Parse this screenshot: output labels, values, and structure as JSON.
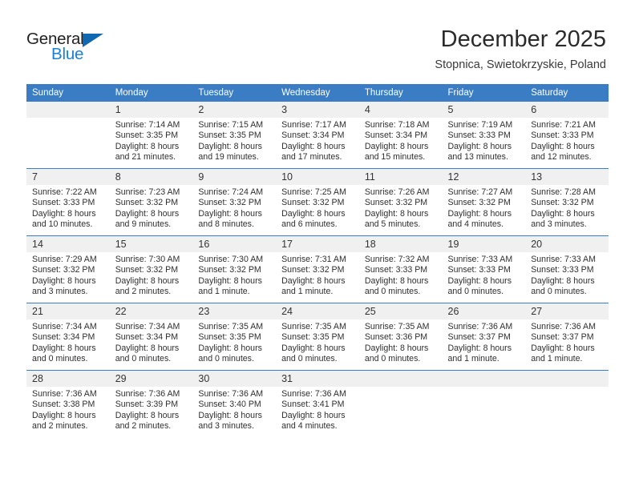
{
  "brand": {
    "name_top": "General",
    "name_bottom": "Blue",
    "color_dark": "#222222",
    "color_blue": "#1b7fd4",
    "triangle_color": "#1068b0"
  },
  "header": {
    "title": "December 2025",
    "subtitle": "Stopnica, Swietokrzyskie, Poland"
  },
  "theme": {
    "header_bg": "#3b7dc4",
    "header_text": "#ffffff",
    "daynum_bg": "#f0f0f0",
    "row_divider": "#3b7dc4"
  },
  "weekday_headers": [
    "Sunday",
    "Monday",
    "Tuesday",
    "Wednesday",
    "Thursday",
    "Friday",
    "Saturday"
  ],
  "weeks": [
    [
      {
        "day": "",
        "sunrise": "",
        "sunset": "",
        "daylight1": "",
        "daylight2": ""
      },
      {
        "day": "1",
        "sunrise": "Sunrise: 7:14 AM",
        "sunset": "Sunset: 3:35 PM",
        "daylight1": "Daylight: 8 hours",
        "daylight2": "and 21 minutes."
      },
      {
        "day": "2",
        "sunrise": "Sunrise: 7:15 AM",
        "sunset": "Sunset: 3:35 PM",
        "daylight1": "Daylight: 8 hours",
        "daylight2": "and 19 minutes."
      },
      {
        "day": "3",
        "sunrise": "Sunrise: 7:17 AM",
        "sunset": "Sunset: 3:34 PM",
        "daylight1": "Daylight: 8 hours",
        "daylight2": "and 17 minutes."
      },
      {
        "day": "4",
        "sunrise": "Sunrise: 7:18 AM",
        "sunset": "Sunset: 3:34 PM",
        "daylight1": "Daylight: 8 hours",
        "daylight2": "and 15 minutes."
      },
      {
        "day": "5",
        "sunrise": "Sunrise: 7:19 AM",
        "sunset": "Sunset: 3:33 PM",
        "daylight1": "Daylight: 8 hours",
        "daylight2": "and 13 minutes."
      },
      {
        "day": "6",
        "sunrise": "Sunrise: 7:21 AM",
        "sunset": "Sunset: 3:33 PM",
        "daylight1": "Daylight: 8 hours",
        "daylight2": "and 12 minutes."
      }
    ],
    [
      {
        "day": "7",
        "sunrise": "Sunrise: 7:22 AM",
        "sunset": "Sunset: 3:33 PM",
        "daylight1": "Daylight: 8 hours",
        "daylight2": "and 10 minutes."
      },
      {
        "day": "8",
        "sunrise": "Sunrise: 7:23 AM",
        "sunset": "Sunset: 3:32 PM",
        "daylight1": "Daylight: 8 hours",
        "daylight2": "and 9 minutes."
      },
      {
        "day": "9",
        "sunrise": "Sunrise: 7:24 AM",
        "sunset": "Sunset: 3:32 PM",
        "daylight1": "Daylight: 8 hours",
        "daylight2": "and 8 minutes."
      },
      {
        "day": "10",
        "sunrise": "Sunrise: 7:25 AM",
        "sunset": "Sunset: 3:32 PM",
        "daylight1": "Daylight: 8 hours",
        "daylight2": "and 6 minutes."
      },
      {
        "day": "11",
        "sunrise": "Sunrise: 7:26 AM",
        "sunset": "Sunset: 3:32 PM",
        "daylight1": "Daylight: 8 hours",
        "daylight2": "and 5 minutes."
      },
      {
        "day": "12",
        "sunrise": "Sunrise: 7:27 AM",
        "sunset": "Sunset: 3:32 PM",
        "daylight1": "Daylight: 8 hours",
        "daylight2": "and 4 minutes."
      },
      {
        "day": "13",
        "sunrise": "Sunrise: 7:28 AM",
        "sunset": "Sunset: 3:32 PM",
        "daylight1": "Daylight: 8 hours",
        "daylight2": "and 3 minutes."
      }
    ],
    [
      {
        "day": "14",
        "sunrise": "Sunrise: 7:29 AM",
        "sunset": "Sunset: 3:32 PM",
        "daylight1": "Daylight: 8 hours",
        "daylight2": "and 3 minutes."
      },
      {
        "day": "15",
        "sunrise": "Sunrise: 7:30 AM",
        "sunset": "Sunset: 3:32 PM",
        "daylight1": "Daylight: 8 hours",
        "daylight2": "and 2 minutes."
      },
      {
        "day": "16",
        "sunrise": "Sunrise: 7:30 AM",
        "sunset": "Sunset: 3:32 PM",
        "daylight1": "Daylight: 8 hours",
        "daylight2": "and 1 minute."
      },
      {
        "day": "17",
        "sunrise": "Sunrise: 7:31 AM",
        "sunset": "Sunset: 3:32 PM",
        "daylight1": "Daylight: 8 hours",
        "daylight2": "and 1 minute."
      },
      {
        "day": "18",
        "sunrise": "Sunrise: 7:32 AM",
        "sunset": "Sunset: 3:33 PM",
        "daylight1": "Daylight: 8 hours",
        "daylight2": "and 0 minutes."
      },
      {
        "day": "19",
        "sunrise": "Sunrise: 7:33 AM",
        "sunset": "Sunset: 3:33 PM",
        "daylight1": "Daylight: 8 hours",
        "daylight2": "and 0 minutes."
      },
      {
        "day": "20",
        "sunrise": "Sunrise: 7:33 AM",
        "sunset": "Sunset: 3:33 PM",
        "daylight1": "Daylight: 8 hours",
        "daylight2": "and 0 minutes."
      }
    ],
    [
      {
        "day": "21",
        "sunrise": "Sunrise: 7:34 AM",
        "sunset": "Sunset: 3:34 PM",
        "daylight1": "Daylight: 8 hours",
        "daylight2": "and 0 minutes."
      },
      {
        "day": "22",
        "sunrise": "Sunrise: 7:34 AM",
        "sunset": "Sunset: 3:34 PM",
        "daylight1": "Daylight: 8 hours",
        "daylight2": "and 0 minutes."
      },
      {
        "day": "23",
        "sunrise": "Sunrise: 7:35 AM",
        "sunset": "Sunset: 3:35 PM",
        "daylight1": "Daylight: 8 hours",
        "daylight2": "and 0 minutes."
      },
      {
        "day": "24",
        "sunrise": "Sunrise: 7:35 AM",
        "sunset": "Sunset: 3:35 PM",
        "daylight1": "Daylight: 8 hours",
        "daylight2": "and 0 minutes."
      },
      {
        "day": "25",
        "sunrise": "Sunrise: 7:35 AM",
        "sunset": "Sunset: 3:36 PM",
        "daylight1": "Daylight: 8 hours",
        "daylight2": "and 0 minutes."
      },
      {
        "day": "26",
        "sunrise": "Sunrise: 7:36 AM",
        "sunset": "Sunset: 3:37 PM",
        "daylight1": "Daylight: 8 hours",
        "daylight2": "and 1 minute."
      },
      {
        "day": "27",
        "sunrise": "Sunrise: 7:36 AM",
        "sunset": "Sunset: 3:37 PM",
        "daylight1": "Daylight: 8 hours",
        "daylight2": "and 1 minute."
      }
    ],
    [
      {
        "day": "28",
        "sunrise": "Sunrise: 7:36 AM",
        "sunset": "Sunset: 3:38 PM",
        "daylight1": "Daylight: 8 hours",
        "daylight2": "and 2 minutes."
      },
      {
        "day": "29",
        "sunrise": "Sunrise: 7:36 AM",
        "sunset": "Sunset: 3:39 PM",
        "daylight1": "Daylight: 8 hours",
        "daylight2": "and 2 minutes."
      },
      {
        "day": "30",
        "sunrise": "Sunrise: 7:36 AM",
        "sunset": "Sunset: 3:40 PM",
        "daylight1": "Daylight: 8 hours",
        "daylight2": "and 3 minutes."
      },
      {
        "day": "31",
        "sunrise": "Sunrise: 7:36 AM",
        "sunset": "Sunset: 3:41 PM",
        "daylight1": "Daylight: 8 hours",
        "daylight2": "and 4 minutes."
      },
      {
        "day": "",
        "sunrise": "",
        "sunset": "",
        "daylight1": "",
        "daylight2": ""
      },
      {
        "day": "",
        "sunrise": "",
        "sunset": "",
        "daylight1": "",
        "daylight2": ""
      },
      {
        "day": "",
        "sunrise": "",
        "sunset": "",
        "daylight1": "",
        "daylight2": ""
      }
    ]
  ]
}
